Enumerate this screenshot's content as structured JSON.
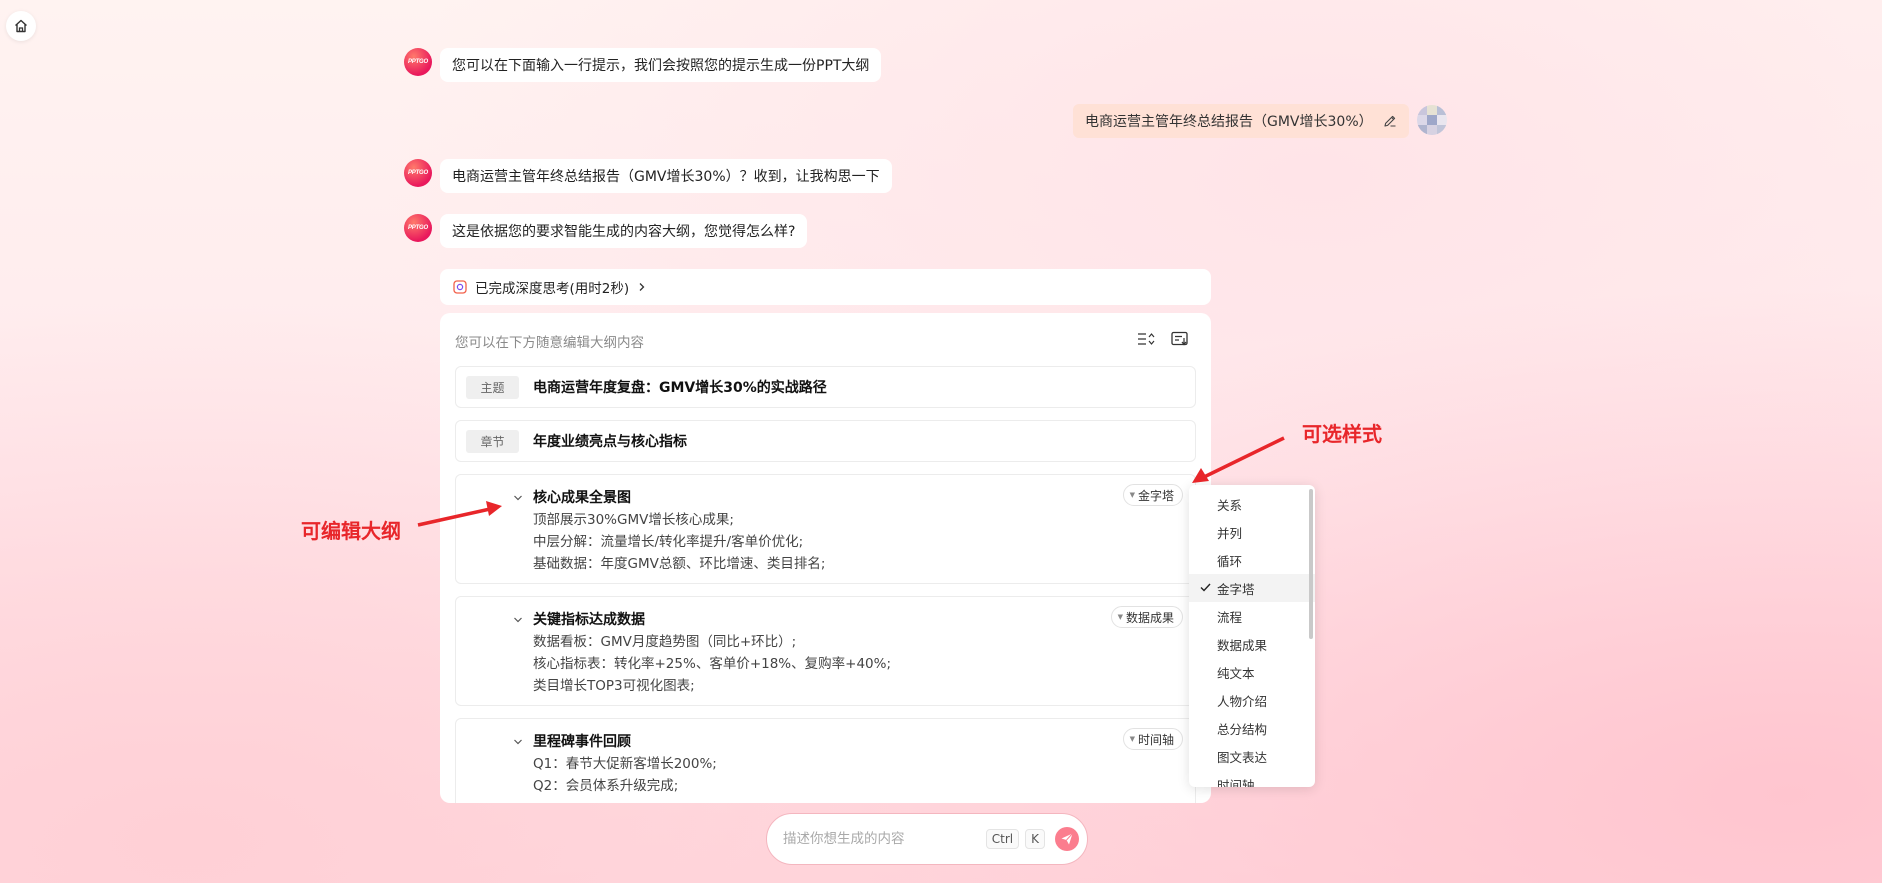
{
  "messages": {
    "bot_avatar_text": "PPTGO",
    "bot1": "您可以在下面输入一行提示，我们会按照您的提示生成一份PPT大纲",
    "user1": "电商运营主管年终总结报告（GMV增长30%）",
    "bot2": "电商运营主管年终总结报告（GMV增长30%）？收到，让我构思一下",
    "bot3": "这是依据您的要求智能生成的内容大纲，您觉得怎么样?"
  },
  "thinking": {
    "label": "已完成深度思考(用时2秒)"
  },
  "outline": {
    "hint": "您可以在下方随意编辑大纲内容",
    "topic": {
      "tag": "主题",
      "title": "电商运营年度复盘：GMV增长30%的实战路径"
    },
    "chapter": {
      "tag": "章节",
      "title": "年度业绩亮点与核心指标"
    },
    "sections": [
      {
        "title": "核心成果全景图",
        "style": "金字塔",
        "lines": [
          "顶部展示30%GMV增长核心成果;",
          "中层分解：流量增长/转化率提升/客单价优化;",
          "基础数据：年度GMV总额、环比增速、类目排名;"
        ]
      },
      {
        "title": "关键指标达成数据",
        "style": "数据成果",
        "lines": [
          "数据看板：GMV月度趋势图（同比+环比）;",
          "核心指标表：转化率+25%、客单价+18%、复购率+40%;",
          "类目增长TOP3可视化图表;"
        ]
      },
      {
        "title": "里程碑事件回顾",
        "style": "时间轴",
        "lines": [
          "Q1：春节大促新客增长200%;",
          "Q2：会员体系升级完成;",
          ""
        ]
      }
    ]
  },
  "style_menu": {
    "selected": "金字塔",
    "options": [
      "关系",
      "并列",
      "循环",
      "金字塔",
      "流程",
      "数据成果",
      "纯文本",
      "人物介绍",
      "总分结构",
      "图文表达",
      "时间轴"
    ]
  },
  "annotations": {
    "editable": "可编辑大纲",
    "styles": "可选样式"
  },
  "input": {
    "placeholder": "描述你想生成的内容",
    "shortcut_ctrl": "Ctrl",
    "shortcut_k": "K"
  },
  "colors": {
    "accent": "#fb7d8e",
    "annotation": "#e8262a",
    "bot_avatar": "#e9185c"
  }
}
